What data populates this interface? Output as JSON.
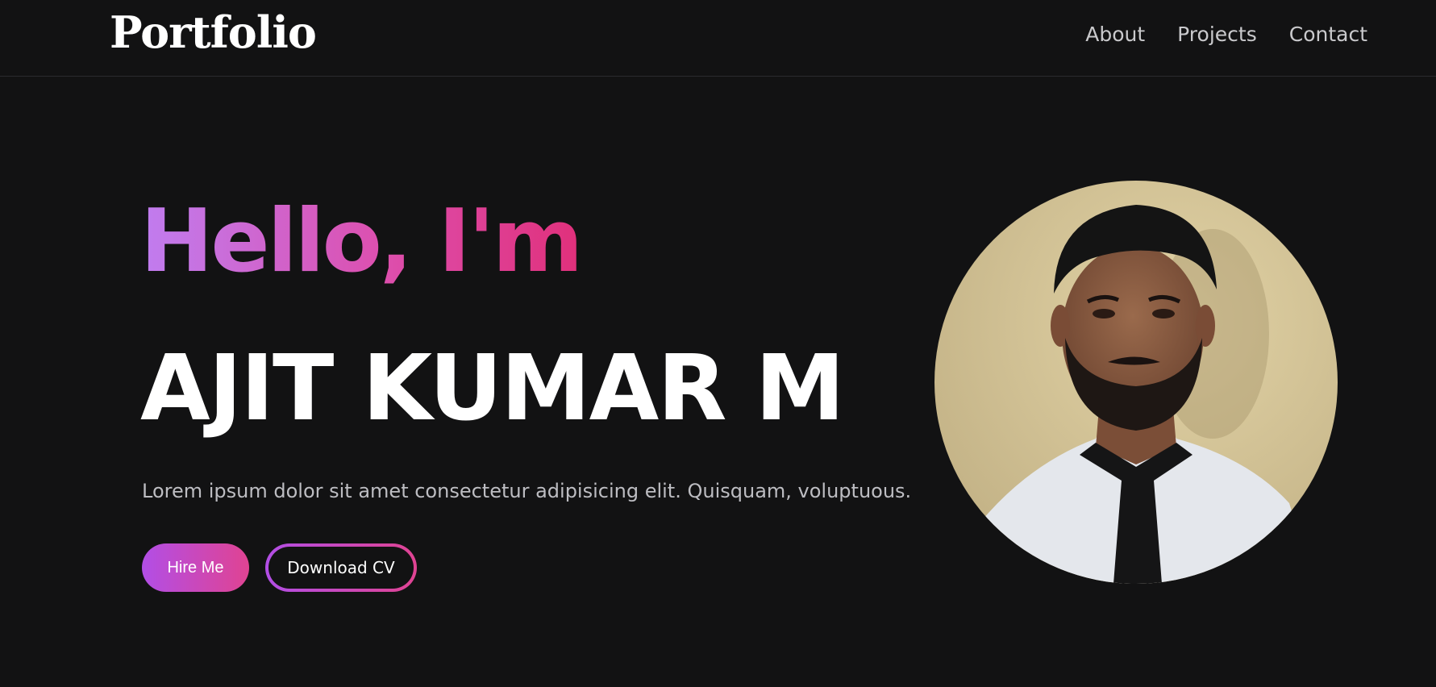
{
  "nav": {
    "logo": "Portfolio",
    "links": [
      {
        "label": "About"
      },
      {
        "label": "Projects"
      },
      {
        "label": "Contact"
      }
    ]
  },
  "hero": {
    "greeting": "Hello, I'm",
    "name": "AJIT KUMAR M",
    "description": "Lorem ipsum dolor sit amet consectetur adipisicing elit. Quisquam, voluptuous.",
    "hire_label": "Hire Me",
    "cv_label": "Download CV"
  },
  "colors": {
    "background": "#121213",
    "gradient_start": "#b24ee6",
    "gradient_end": "#e04392",
    "text": "#ffffff"
  }
}
